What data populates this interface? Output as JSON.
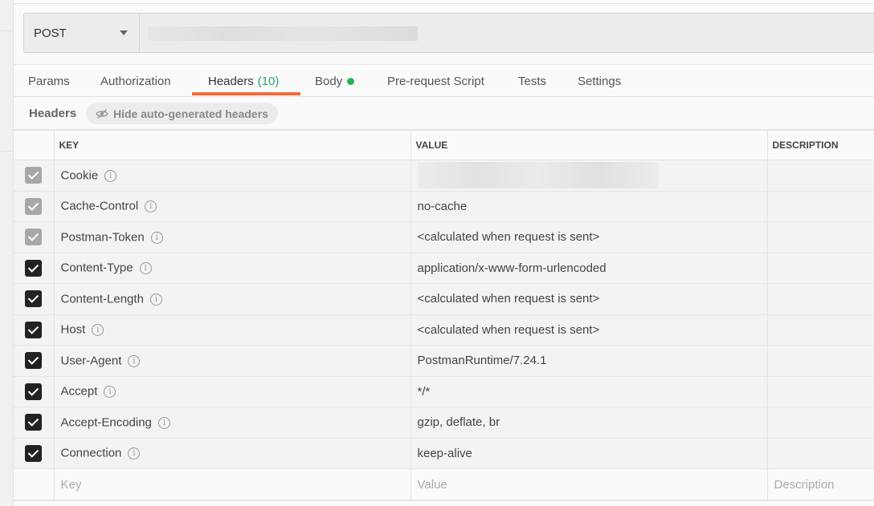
{
  "request": {
    "method": "POST",
    "url_obscured": true
  },
  "tabs": [
    {
      "label": "Params"
    },
    {
      "label": "Authorization"
    },
    {
      "label": "Headers",
      "count": "(10)"
    },
    {
      "label": "Body"
    },
    {
      "label": "Pre-request Script"
    },
    {
      "label": "Tests"
    },
    {
      "label": "Settings"
    }
  ],
  "headers_bar": {
    "title": "Headers",
    "toggle_label": "Hide auto-generated headers"
  },
  "table": {
    "columns": [
      "KEY",
      "VALUE",
      "DESCRIPTION"
    ],
    "rows": [
      {
        "key": "Cookie",
        "value": "",
        "checked": true,
        "auto": true
      },
      {
        "key": "Cache-Control",
        "value": "no-cache",
        "checked": true,
        "auto": true
      },
      {
        "key": "Postman-Token",
        "value": "<calculated when request is sent>",
        "checked": true,
        "auto": true
      },
      {
        "key": "Content-Type",
        "value": "application/x-www-form-urlencoded",
        "checked": true,
        "auto": false
      },
      {
        "key": "Content-Length",
        "value": "<calculated when request is sent>",
        "checked": true,
        "auto": false
      },
      {
        "key": "Host",
        "value": "<calculated when request is sent>",
        "checked": true,
        "auto": false
      },
      {
        "key": "User-Agent",
        "value": "PostmanRuntime/7.24.1",
        "checked": true,
        "auto": false
      },
      {
        "key": "Accept",
        "value": "*/*",
        "checked": true,
        "auto": false
      },
      {
        "key": "Accept-Encoding",
        "value": "gzip, deflate, br",
        "checked": true,
        "auto": false
      },
      {
        "key": "Connection",
        "value": "keep-alive",
        "checked": true,
        "auto": false
      }
    ],
    "new_row": {
      "key_placeholder": "Key",
      "value_placeholder": "Value",
      "description_placeholder": "Description"
    }
  },
  "colors": {
    "accent_underline": "#f26b3a",
    "count_green": "#26a269",
    "body_dot": "#26b35a"
  }
}
